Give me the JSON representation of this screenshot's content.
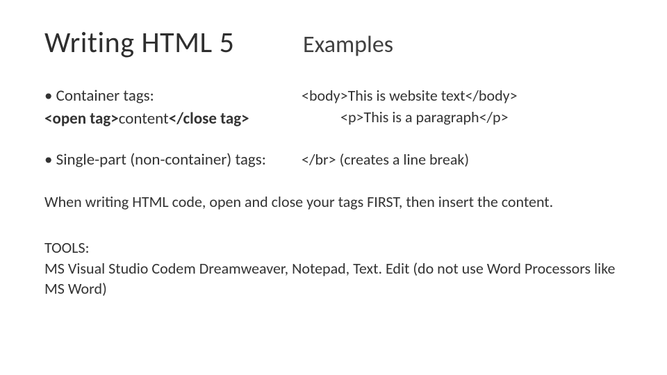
{
  "titles": {
    "left": "Writing HTML 5",
    "right": "Examples"
  },
  "bullet1": {
    "heading": "• Container tags:",
    "openTag": "<open tag>",
    "content": "content",
    "closeTag": "</close tag>"
  },
  "example1": {
    "line1": "<body>This is website text</body>",
    "line2": "<p>This is a paragraph</p>"
  },
  "bullet2": {
    "heading": "• Single-part (non-container) tags:"
  },
  "example2": {
    "line1": "</br> (creates a line break)"
  },
  "note": "When writing HTML code, open and close your tags FIRST, then insert the content.",
  "tools": {
    "label": "TOOLS:",
    "text": "MS Visual Studio Codem Dreamweaver, Notepad, Text. Edit (do not use Word Processors like MS Word)"
  }
}
